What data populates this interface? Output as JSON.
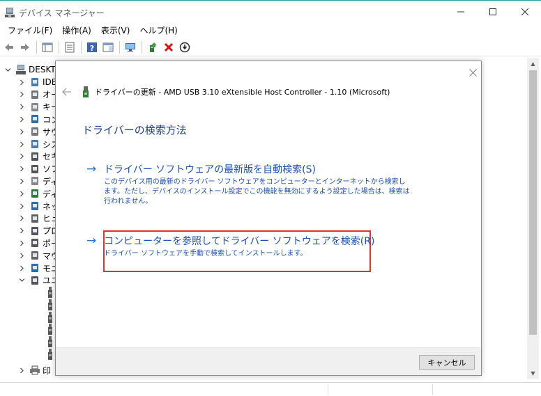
{
  "window": {
    "title": "デバイス マネージャー"
  },
  "menu": [
    {
      "label": "ファイル(F)"
    },
    {
      "label": "操作(A)"
    },
    {
      "label": "表示(V)"
    },
    {
      "label": "ヘルプ(H)"
    }
  ],
  "toolbar": {
    "icons": [
      "back-icon",
      "forward-icon",
      "properties-icon",
      "help-icon",
      "view-icon",
      "monitor-icon",
      "update-driver-icon",
      "uninstall-icon",
      "scan-icon"
    ]
  },
  "tree": {
    "root": "DESKT",
    "items": [
      {
        "label": "IDE"
      },
      {
        "label": "オー"
      },
      {
        "label": "キー"
      },
      {
        "label": "コン"
      },
      {
        "label": "サウ"
      },
      {
        "label": "シス"
      },
      {
        "label": "セキ"
      },
      {
        "label": "ソフ"
      },
      {
        "label": "ディ"
      },
      {
        "label": "ディ"
      },
      {
        "label": "ネッ"
      },
      {
        "label": "ヒュ"
      },
      {
        "label": "プロ"
      },
      {
        "label": "ポー"
      },
      {
        "label": "マウ"
      },
      {
        "label": "モニ"
      },
      {
        "label": "ユニ"
      }
    ],
    "bottom": {
      "label": "印"
    }
  },
  "dialog": {
    "header": "ドライバーの更新 - AMD USB 3.10 eXtensible Host Controller - 1.10 (Microsoft)",
    "heading": "ドライバーの検索方法",
    "option1": {
      "title": "ドライバー ソフトウェアの最新版を自動検索(S)",
      "desc": "このデバイス用の最新のドライバー ソフトウェアをコンピューターとインターネットから検索します。ただし、デバイスのインストール設定でこの機能を無効にするよう設定した場合は、検索は行われません。"
    },
    "option2": {
      "title": "コンピューターを参照してドライバー ソフトウェアを検索(R)",
      "desc": "ドライバー ソフトウェアを手動で検索してインストールします。"
    },
    "cancel_label": "キャンセル"
  },
  "colors": {
    "link": "#1a4fb6",
    "highlight": "#e03030"
  }
}
